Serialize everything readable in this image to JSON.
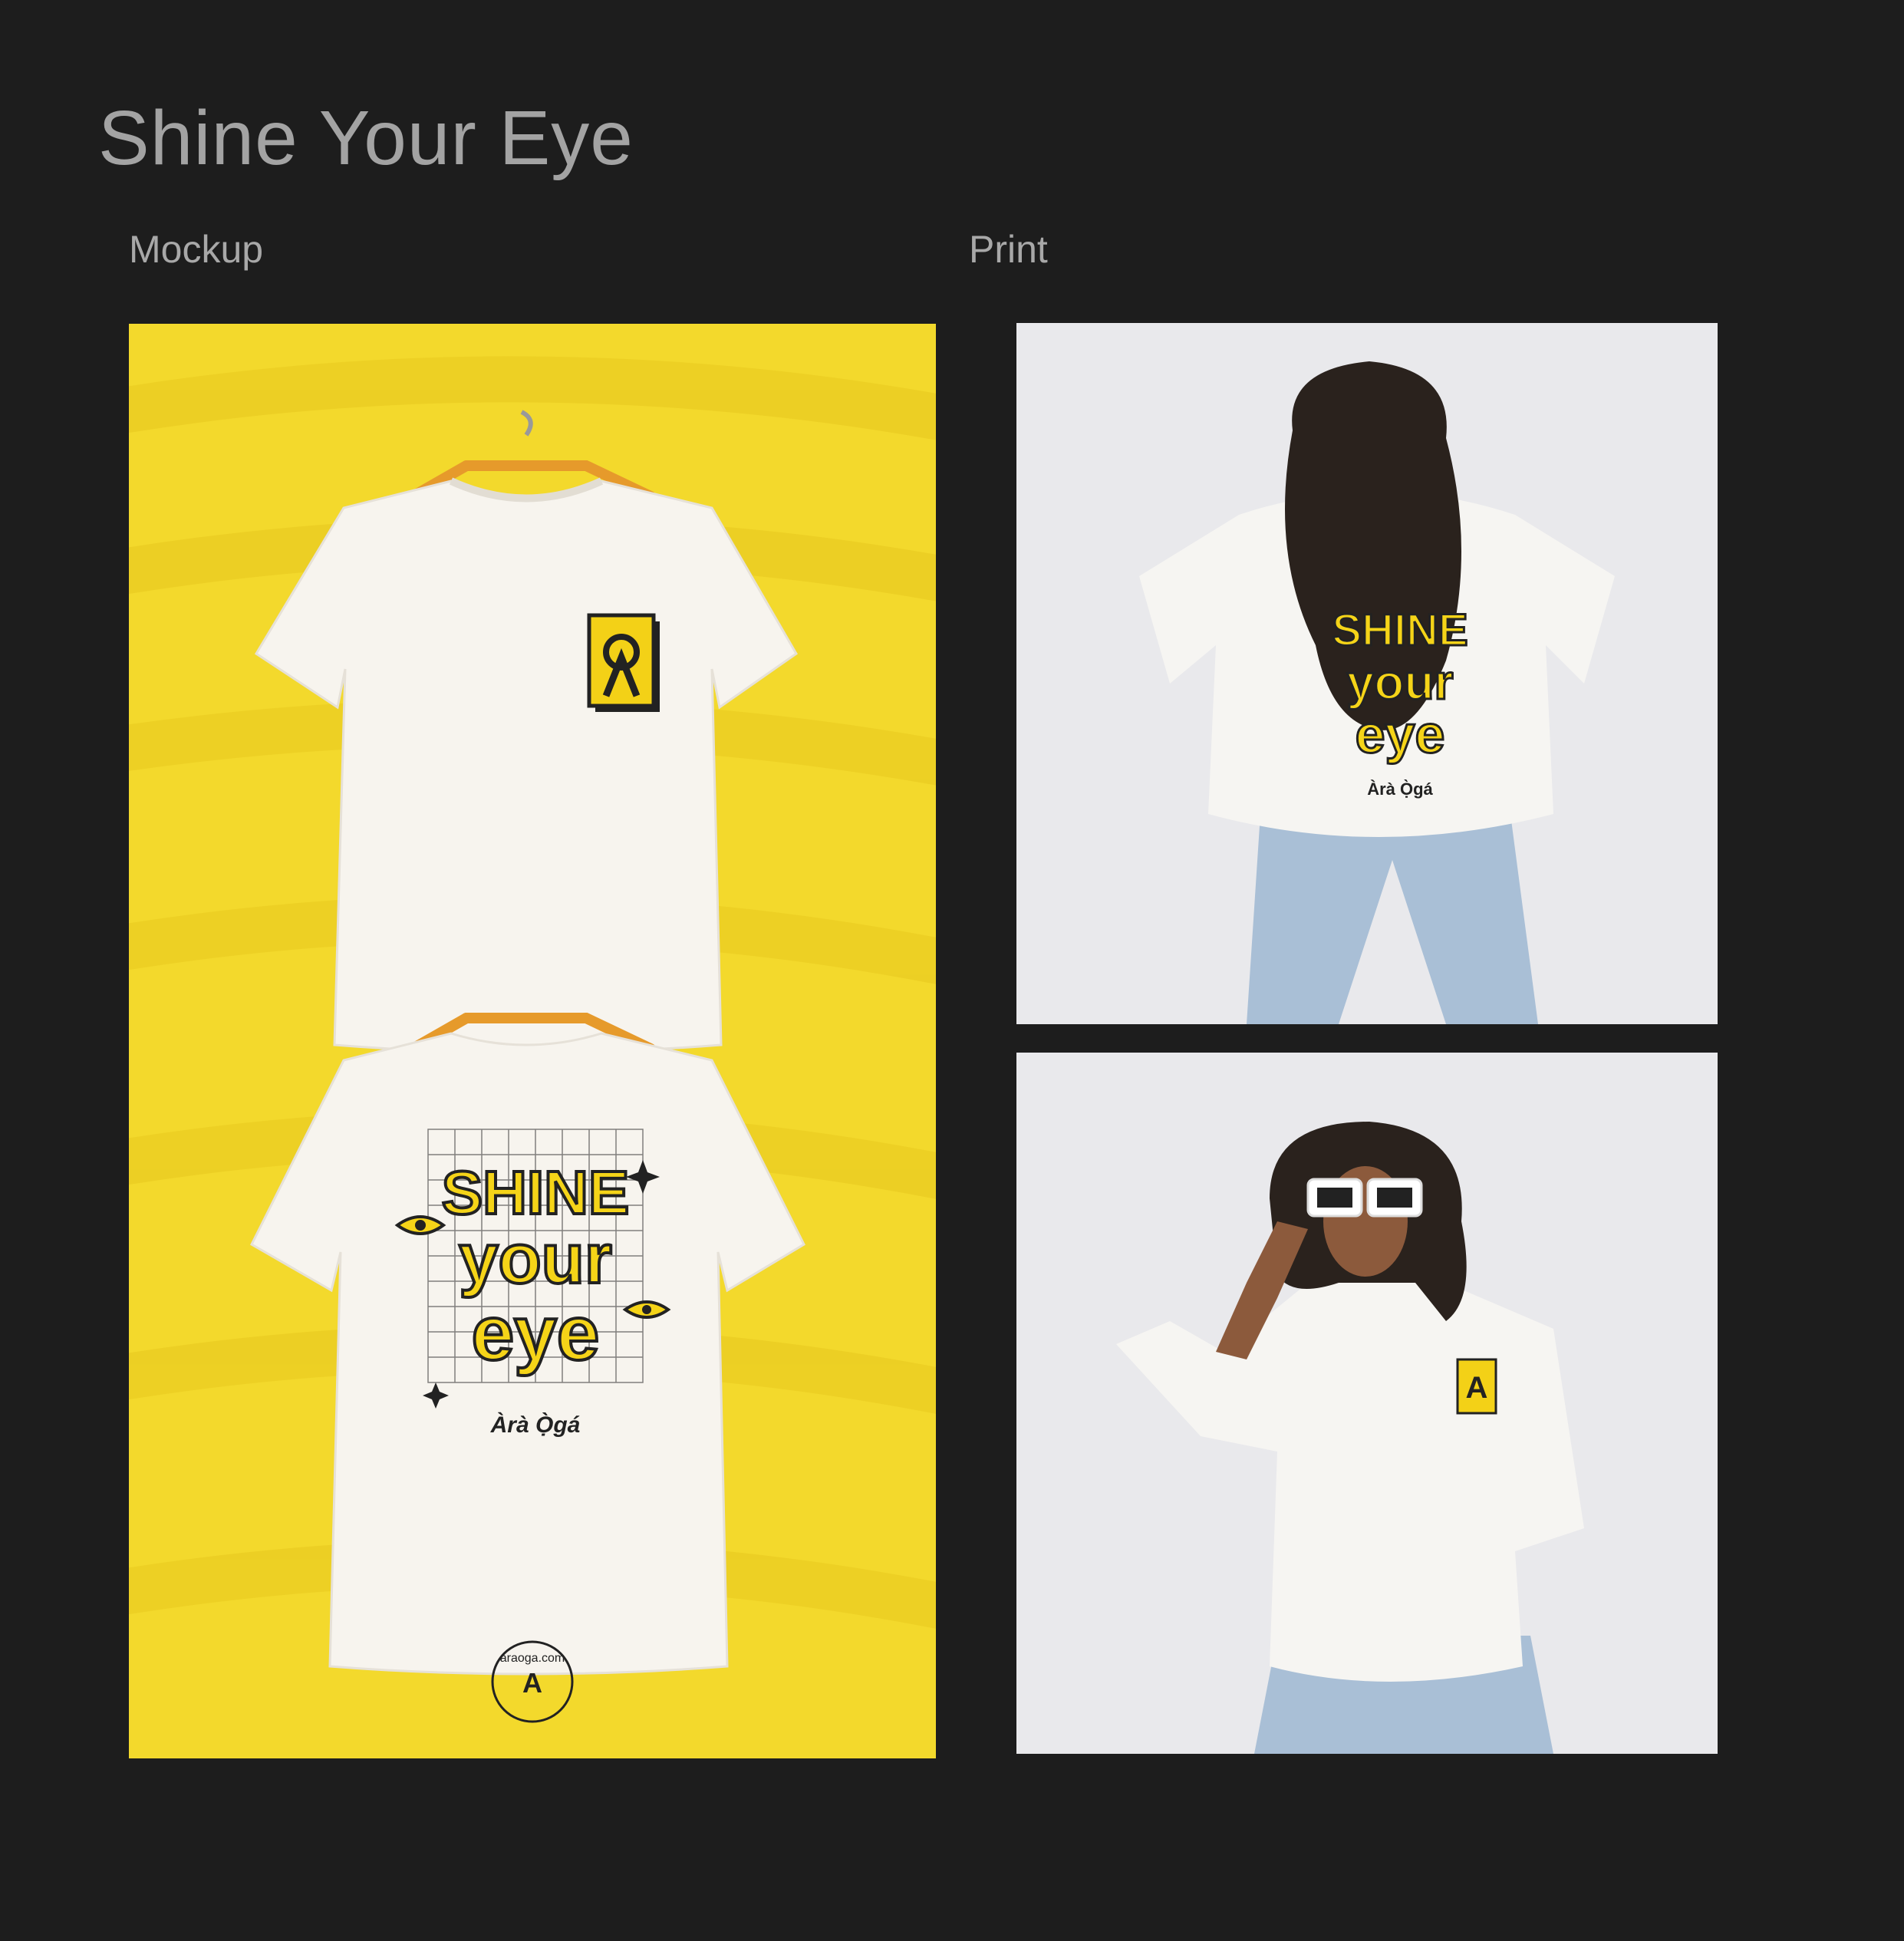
{
  "page": {
    "title": "Shine Your Eye",
    "sections": {
      "mockup_label": "Mockup",
      "print_label": "Print"
    }
  },
  "mockup": {
    "print_lines": [
      "SHINE",
      "your",
      "eye"
    ],
    "brand_name": "Àrà Ọ̀gá",
    "badge_text": "araoga.com",
    "logo_letters": "A"
  },
  "print_photos": {
    "top": {
      "print_lines": [
        "SHINE",
        "your",
        "eye"
      ],
      "brand_name": "Àrà Ọ̀gá"
    },
    "bottom": {
      "logo_letters": "A"
    }
  },
  "colors": {
    "background": "#1d1d1d",
    "accent_yellow": "#f3d92c",
    "print_yellow": "#f5d418",
    "shirt_white": "#f7f4ee",
    "photo_background": "#e9e9ec",
    "denim": "#a9bfd6"
  }
}
